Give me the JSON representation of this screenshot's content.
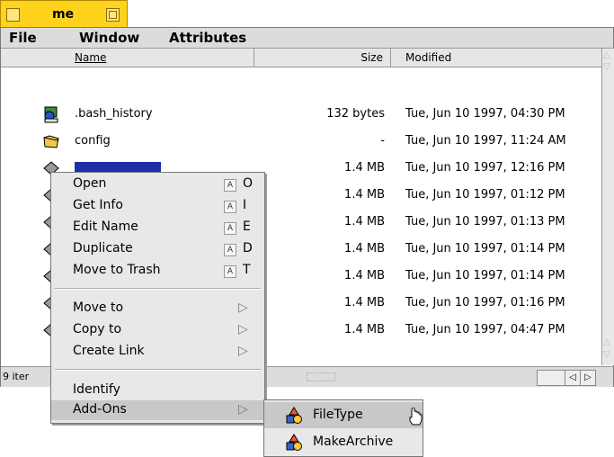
{
  "window": {
    "title": "me"
  },
  "menubar": {
    "items": [
      "File",
      "Window",
      "Attributes"
    ]
  },
  "columns": {
    "name": "Name",
    "size": "Size",
    "modified": "Modified"
  },
  "files": [
    {
      "name": ".bash_history",
      "size": "132 bytes",
      "modified": "Tue, Jun 10 1997, 04:30 PM",
      "icon": "terminal-doc-icon"
    },
    {
      "name": "config",
      "size": "-",
      "modified": "Tue, Jun 10 1997, 11:24 AM",
      "icon": "folder-icon"
    },
    {
      "name": "",
      "size": "1.4 MB",
      "modified": "Tue, Jun 10 1997, 12:16 PM",
      "icon": "file-icon"
    },
    {
      "name": "",
      "size": "1.4 MB",
      "modified": "Tue, Jun 10 1997, 01:12 PM",
      "icon": "file-icon"
    },
    {
      "name": "",
      "size": "1.4 MB",
      "modified": "Tue, Jun 10 1997, 01:13 PM",
      "icon": "file-icon"
    },
    {
      "name": "",
      "size": "1.4 MB",
      "modified": "Tue, Jun 10 1997, 01:14 PM",
      "icon": "file-icon"
    },
    {
      "name": "",
      "size": "1.4 MB",
      "modified": "Tue, Jun 10 1997, 01:14 PM",
      "icon": "file-icon"
    },
    {
      "name": "",
      "size": "1.4 MB",
      "modified": "Tue, Jun 10 1997, 01:16 PM",
      "icon": "file-icon"
    },
    {
      "name": "",
      "size": "1.4 MB",
      "modified": "Tue, Jun 10 1997, 04:47 PM",
      "icon": "file-icon"
    }
  ],
  "status": {
    "count": "9 iter"
  },
  "context_menu": {
    "items": [
      {
        "label": "Open",
        "key": "A",
        "letter": "O"
      },
      {
        "label": "Get Info",
        "key": "A",
        "letter": "I"
      },
      {
        "label": "Edit Name",
        "key": "A",
        "letter": "E"
      },
      {
        "label": "Duplicate",
        "key": "A",
        "letter": "D"
      },
      {
        "label": "Move to Trash",
        "key": "A",
        "letter": "T"
      }
    ],
    "submenus": [
      {
        "label": "Move to"
      },
      {
        "label": "Copy to"
      },
      {
        "label": "Create Link"
      }
    ],
    "identify": "Identify",
    "addons": "Add-Ons"
  },
  "addons_submenu": {
    "items": [
      "FileType",
      "MakeArchive"
    ]
  },
  "colors": {
    "tab": "#ffd21c",
    "selection": "#1d2fa8",
    "menu_bg": "#e8e8e8"
  }
}
